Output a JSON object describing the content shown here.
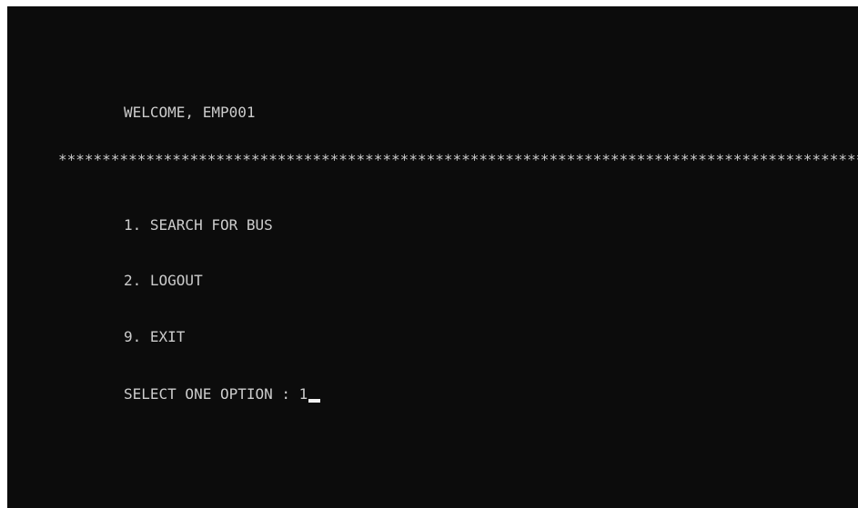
{
  "console": {
    "welcome": "WELCOME, EMP001",
    "separator": "****************************************************************************************************",
    "menu": [
      {
        "label": "1. SEARCH FOR BUS"
      },
      {
        "label": "2. LOGOUT"
      },
      {
        "label": "9. EXIT"
      }
    ],
    "prompt": "SELECT ONE OPTION : ",
    "input_value": "1"
  }
}
